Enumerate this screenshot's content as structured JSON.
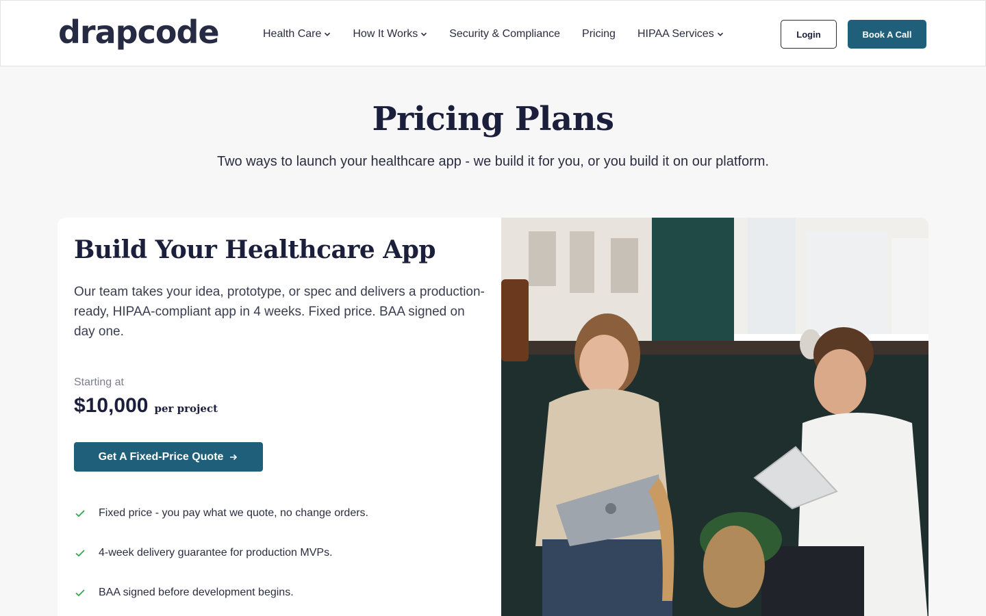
{
  "header": {
    "logo_text": "drapcode",
    "nav": [
      {
        "label": "Health Care",
        "has_dropdown": true
      },
      {
        "label": "How It Works",
        "has_dropdown": true
      },
      {
        "label": "Security & Compliance",
        "has_dropdown": false
      },
      {
        "label": "Pricing",
        "has_dropdown": false
      },
      {
        "label": "HIPAA Services",
        "has_dropdown": true
      }
    ],
    "login_label": "Login",
    "book_call_label": "Book A Call"
  },
  "hero": {
    "title": "Pricing Plans",
    "subtitle": "Two ways to launch your healthcare app - we build it for you, or you build it on our platform."
  },
  "plan": {
    "title": "Build Your Healthcare App",
    "description": "Our team takes your idea, prototype, or spec and delivers a production-ready, HIPAA-compliant app in 4 weeks. Fixed price. BAA signed on day one.",
    "price_label": "Starting at",
    "price_amount": "$10,000",
    "price_unit": "per project",
    "cta_label": "Get A Fixed-Price Quote",
    "features": [
      "Fixed price - you pay what we quote, no change orders.",
      "4-week delivery guarantee for production MVPs.",
      "BAA signed before development begins."
    ],
    "image_alt": "Two people working together with laptop and tablet by a window"
  },
  "colors": {
    "brand": "#1f5f7a",
    "heading": "#1b1f3b",
    "check": "#2fa84f",
    "page_bg": "#f7f7f8"
  },
  "icons": {
    "nav_dropdown": "chevron-down-icon",
    "cta_arrow": "arrow-right-icon",
    "feature_bullet": "check-icon"
  }
}
